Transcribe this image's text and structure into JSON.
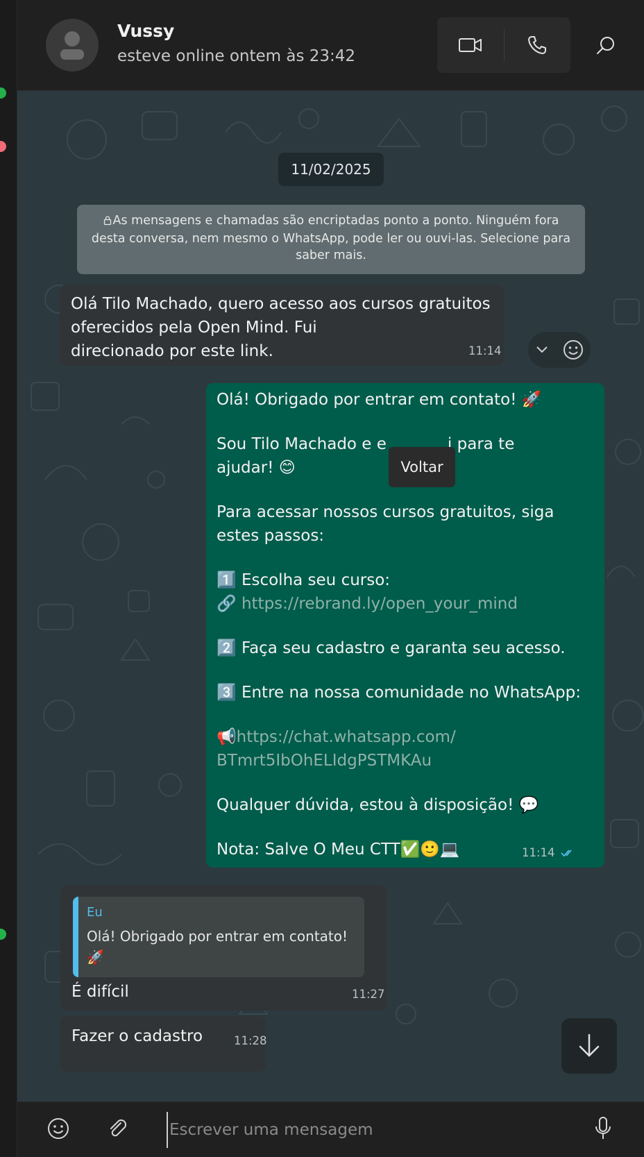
{
  "colors": {
    "outgoing_bubble": "#005c4b",
    "incoming_bubble": "#303436",
    "chat_background": "#2c3a40",
    "quote_accent": "#53bdeb",
    "read_ticks": "#53bdeb"
  },
  "header": {
    "contact_name": "Vussy",
    "status": "esteve online ontem às 23:42",
    "icons": [
      "video-call-icon",
      "voice-call-icon",
      "search-icon"
    ]
  },
  "chat": {
    "date_chip": "11/02/2025",
    "encryption_notice": "As mensagens e chamadas são encriptadas ponto a ponto. Ninguém fora desta conversa, nem mesmo o WhatsApp, pode ler ou ouvi-las. Selecione para saber mais.",
    "tooltip": "Voltar",
    "messages": [
      {
        "direction": "incoming",
        "text": "Olá Tilo Machado, quero acesso aos cursos gratuitos\noferecidos pela Open Mind. Fui\ndirecionado por este link.",
        "time": "11:14"
      },
      {
        "direction": "outgoing",
        "lines": {
          "l1": "Olá! Obrigado por entrar em contato! 🚀",
          "l2": "Sou Tilo Machado e e",
          "l2b": "i para te",
          "l3": "ajudar! 😊",
          "l4": "Para acessar nossos cursos gratuitos, siga",
          "l5": "estes passos:",
          "l6": "1️⃣ Escolha seu curso:",
          "l7_icon": "🔗",
          "l7_link": "https://rebrand.ly/open_your_mind",
          "l8": "2️⃣ Faça seu cadastro e garanta seu acesso.",
          "l9": "3️⃣ Entre na nossa comunidade no WhatsApp:",
          "l10_icon": "📢",
          "l10_link": "https://chat.whatsapp.com/",
          "l11_link": "BTmrt5IbOhELIdgPSTMKAu",
          "l12": "Qualquer dúvida, estou à disposição! 💬",
          "l13": "Nota: Salve O Meu CTT✅🙂💻"
        },
        "time": "11:14",
        "status": "read"
      },
      {
        "direction": "incoming",
        "quote_author": "Eu",
        "quote_text": "Olá! Obrigado por entrar em contato! 🚀\n...",
        "text": "É difícil",
        "time": "11:27"
      },
      {
        "direction": "incoming",
        "text": "Fazer o cadastro",
        "time": "11:28"
      }
    ]
  },
  "composer": {
    "placeholder": "Escrever uma mensagem"
  }
}
